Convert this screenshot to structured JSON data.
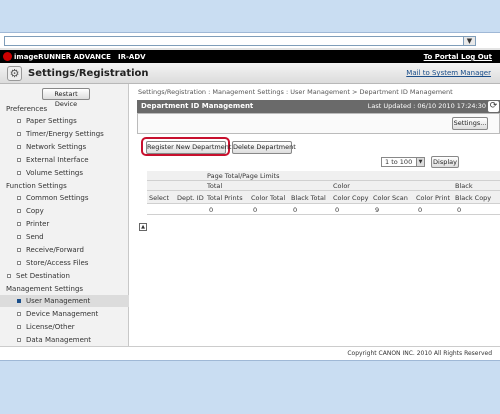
{
  "header": {
    "brand": "imageRUNNER ADVANCE",
    "model": "IR-ADV",
    "portal_logout": "To Portal Log Out"
  },
  "title_bar": {
    "title": "Settings/Registration",
    "mail_link": "Mail to System Manager"
  },
  "sidebar": {
    "restart_button": "Restart Device",
    "groups": [
      {
        "heading": "Preferences",
        "items": [
          "Paper Settings",
          "Timer/Energy Settings",
          "Network Settings",
          "External Interface",
          "Volume Settings"
        ]
      },
      {
        "heading": "Function Settings",
        "items": [
          "Common Settings",
          "Copy",
          "Printer",
          "Send",
          "Receive/Forward",
          "Store/Access Files"
        ]
      },
      {
        "heading": "",
        "items": [
          "Set Destination"
        ]
      },
      {
        "heading": "Management Settings",
        "items": [
          "User Management",
          "Device Management",
          "License/Other",
          "Data Management"
        ]
      }
    ],
    "selected_item": "User Management"
  },
  "main": {
    "breadcrumb": "Settings/Registration : Management Settings : User Management > Department ID Management",
    "panel_title": "Department ID Management",
    "last_updated": "Last Updated : 06/10 2010 17:24:30",
    "settings_button": "Settings...",
    "register_button": "Register New Department",
    "delete_button": "Delete Department",
    "range_select": "1 to 100",
    "display_button": "Display",
    "table": {
      "group_header": "Page Total/Page Limits",
      "sub_headers": [
        "Total",
        "Color",
        "Black"
      ],
      "columns": [
        "Select",
        "Dept. ID",
        "Total Prints",
        "Color Total",
        "Black Total",
        "Color Copy",
        "Color Scan",
        "Color Print",
        "Black Copy"
      ],
      "row": [
        "",
        "",
        "0",
        "0",
        "0",
        "0",
        "9",
        "0",
        "0"
      ]
    }
  },
  "footer": {
    "copyright": "Copyright CANON INC. 2010 All Rights Reserved"
  },
  "colors": {
    "header_bg": "#000000",
    "panel_header_bg": "#6a6a6a",
    "highlight": "#c8102e",
    "link": "#1a4e8a",
    "browser_chrome": "#c9ddf2"
  }
}
